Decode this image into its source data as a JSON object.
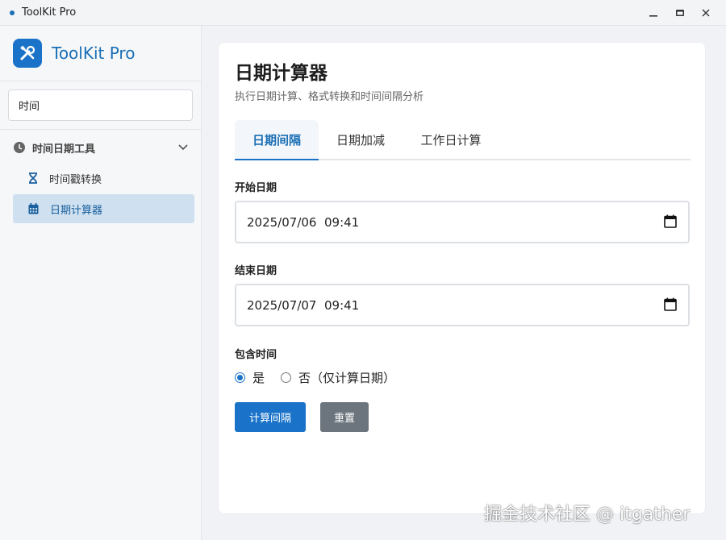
{
  "window": {
    "title": "ToolKit Pro"
  },
  "sidebar": {
    "brand": "ToolKit Pro",
    "search_value": "时间",
    "group": {
      "label": "时间日期工具",
      "items": [
        {
          "label": "时间戳转换",
          "icon": "hourglass-icon"
        },
        {
          "label": "日期计算器",
          "icon": "calendar-icon",
          "active": true
        }
      ]
    }
  },
  "main": {
    "title": "日期计算器",
    "description": "执行日期计算、格式转换和时间间隔分析",
    "tabs": [
      {
        "label": "日期间隔",
        "active": true
      },
      {
        "label": "日期加减"
      },
      {
        "label": "工作日计算"
      }
    ],
    "start_date": {
      "label": "开始日期",
      "value": "2025/07/06  09:41"
    },
    "end_date": {
      "label": "结束日期",
      "value": "2025/07/07  09:41"
    },
    "include_time": {
      "label": "包含时间",
      "options": [
        {
          "label": "是",
          "checked": true
        },
        {
          "label": "否（仅计算日期）",
          "checked": false
        }
      ]
    },
    "buttons": {
      "calculate": "计算间隔",
      "reset": "重置"
    }
  },
  "watermark": "掘金技术社区 @ itgather",
  "colors": {
    "accent": "#1a73c9",
    "active_bg": "#cfe0f0",
    "secondary_button": "#6c757d"
  }
}
